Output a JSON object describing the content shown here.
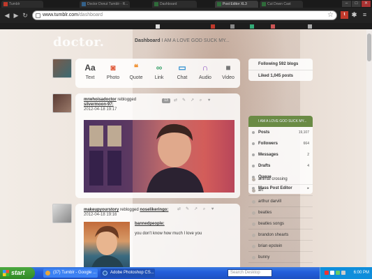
{
  "browser": {
    "tabs": [
      {
        "label": "Tumblr",
        "active": false
      },
      {
        "label": "Doctor Donut Tumblr - R...",
        "active": false
      },
      {
        "label": "Dashboard",
        "active": false
      },
      {
        "label": "Post Editor XL3",
        "active": true
      },
      {
        "label": "Cut Down Cast",
        "active": false
      }
    ],
    "url_host": "www.tumblr.com",
    "url_path": "/dashboard",
    "win_min": "–",
    "win_max": "□",
    "win_close": "✕"
  },
  "page": {
    "logo": "doctor.",
    "dashboard_label": "Dashboard",
    "dashboard_marquee": "I AM A LOVE GOD SUCK MY...",
    "post_types": [
      {
        "label": "Text",
        "glyph": "Aa",
        "color": "#444444"
      },
      {
        "label": "Photo",
        "glyph": "◙",
        "color": "#e05a3a"
      },
      {
        "label": "Quote",
        "glyph": "❝",
        "color": "#f0902f"
      },
      {
        "label": "Link",
        "glyph": "∞",
        "color": "#38a16a"
      },
      {
        "label": "Chat",
        "glyph": "▭",
        "color": "#2f8fd0"
      },
      {
        "label": "Audio",
        "glyph": "∩",
        "color": "#8a4fbf"
      },
      {
        "label": "Video",
        "glyph": "■",
        "color": "#777777"
      }
    ],
    "posts": [
      {
        "user": "mrwhoisadoctor",
        "reblogged_text": "reblogged",
        "source": "silvermoon-97:",
        "date": "2012-04-18 19:17",
        "notes": "13"
      },
      {
        "user": "makeupyourstory",
        "reblogged_text": "reblogged",
        "source": "noselikeringo:",
        "date": "2012-04-18 19:16",
        "caption_user": "bannedpeople:",
        "caption_text": "you don't know how much I love you"
      }
    ],
    "sidebar": {
      "following": "Following 592 blogs",
      "liked": "Liked 1,045 posts",
      "blog_title": "I AM A LOVE GOD SUCK MY...",
      "stats": [
        {
          "label": "Posts",
          "count": "19,107"
        },
        {
          "label": "Followers",
          "count": "664"
        },
        {
          "label": "Messages",
          "count": "2"
        },
        {
          "label": "Drafts",
          "count": "4"
        },
        {
          "label": "Queue",
          "count": ""
        },
        {
          "label": "Mass Post Editor",
          "count": "▸"
        }
      ],
      "tags": [
        "animal crossing",
        "art",
        "arthur darvill",
        "beatles",
        "beatles songs",
        "brandon shearts",
        "brian epstein",
        "bunny"
      ]
    }
  },
  "taskbar": {
    "start": "start",
    "tasks": [
      {
        "label": "(37) Tumblr - Google ...",
        "color": "#e8a73a"
      },
      {
        "label": "Adobe Photoshop CS...",
        "color": "#2c5fa8"
      }
    ],
    "search_placeholder": "Search Desktop",
    "clock": "6:00 PM"
  },
  "colors": {
    "chrome_dark": "#1a1a1a",
    "sidebar_header": "#6a8b45",
    "taskbar_blue": "#245edb",
    "start_green": "#2f8a26"
  }
}
